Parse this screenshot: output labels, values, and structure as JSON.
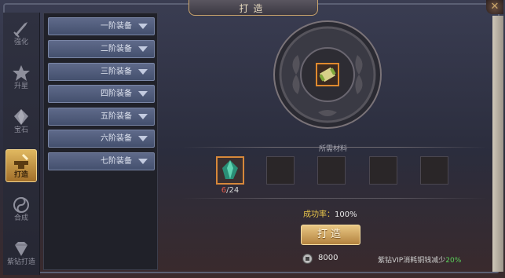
{
  "window": {
    "title": "打造",
    "close_icon": "close-icon"
  },
  "tabs": [
    {
      "label": "强化",
      "icon": "sword-icon",
      "active": false
    },
    {
      "label": "升星",
      "icon": "star-icon",
      "active": false
    },
    {
      "label": "宝石",
      "icon": "gem-icon",
      "active": false
    },
    {
      "label": "打造",
      "icon": "anvil-icon",
      "active": true
    },
    {
      "label": "合成",
      "icon": "swirl-icon",
      "active": false
    },
    {
      "label": "紫钻打造",
      "icon": "diamond-icon",
      "active": false
    }
  ],
  "tiers": [
    {
      "label": "一阶装备"
    },
    {
      "label": "二阶装备"
    },
    {
      "label": "三阶装备"
    },
    {
      "label": "四阶装备"
    },
    {
      "label": "五阶装备"
    },
    {
      "label": "六阶装备"
    },
    {
      "label": "七阶装备"
    }
  ],
  "forge": {
    "item_icon": "scroll-item-icon",
    "materials_title": "所需材料",
    "material": {
      "icon": "green-crystal-icon",
      "have": "6",
      "need": "/24"
    },
    "success_label": "成功率：",
    "success_value": "100%",
    "button_label": "打造",
    "cost_icon": "silver-coin-icon",
    "cost_value": "8000",
    "vip_note_prefix": "紫钻VIP消耗铜钱减少",
    "vip_note_pct": "20%"
  },
  "colors": {
    "active_tab": "#e0b860",
    "slot_border_filled": "#d7883a",
    "material_shortfall": "#e25a4a",
    "success_rate": "#e8c54a",
    "vip_discount": "#5ad25a"
  }
}
